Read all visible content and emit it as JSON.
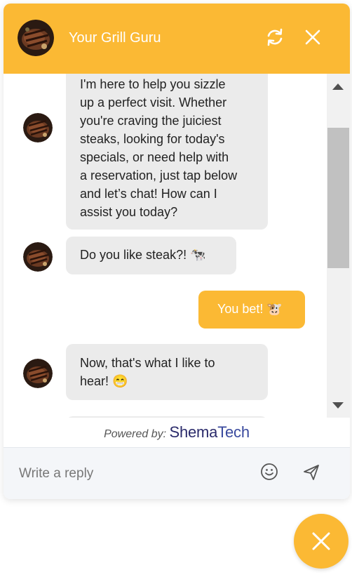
{
  "header": {
    "title": "Your Grill Guru",
    "accent_color": "#FBB934",
    "refresh_icon": "refresh-icon",
    "close_icon": "close-icon"
  },
  "messages": [
    {
      "from": "bot",
      "lines": [
        "I'm here to help you sizzle",
        "up a perfect visit. Whether",
        "you're craving the juiciest",
        "steaks, looking for today's",
        "specials, or need help with",
        "a reservation, just tap below",
        "and let’s chat! How can I",
        "assist you today?"
      ]
    },
    {
      "from": "bot",
      "lines": [
        "Do you like steak?! 🐄"
      ]
    },
    {
      "from": "user",
      "lines": [
        "You bet! 🐮"
      ]
    },
    {
      "from": "bot",
      "lines": [
        "Now, that's what I like to",
        "hear! 😁"
      ]
    }
  ],
  "footer": {
    "powered_label": "Powered by:",
    "brand_part1": "Shema",
    "brand_part2": "Tech"
  },
  "reply": {
    "placeholder": "Write a reply",
    "emoji_icon": "smiley-icon",
    "send_icon": "send-icon"
  },
  "fab": {
    "icon": "close-icon"
  }
}
